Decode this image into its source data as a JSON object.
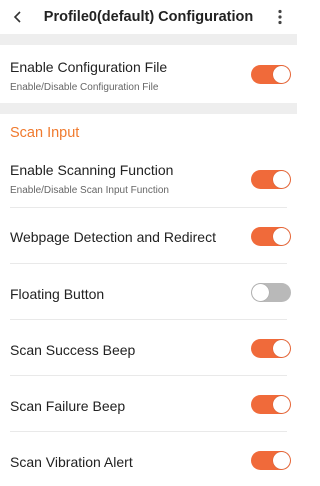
{
  "header": {
    "back_icon": "back-chevron-icon",
    "title": "Profile0(default) Configuration",
    "more_icon": "more-vertical-icon"
  },
  "profile": {
    "label": "Enable Configuration File",
    "sub": "Enable/Disable Configuration File",
    "enabled": true
  },
  "scan_input": {
    "section_title": "Scan Input",
    "items": [
      {
        "label": "Enable Scanning Function",
        "sub": "Enable/Disable Scan Input Function",
        "enabled": true
      },
      {
        "label": "Webpage Detection and Redirect",
        "enabled": true
      },
      {
        "label": "Floating Button",
        "enabled": false
      },
      {
        "label": "Scan Success Beep",
        "enabled": true
      },
      {
        "label": "Scan Failure Beep",
        "enabled": true
      },
      {
        "label": "Scan Vibration Alert",
        "enabled": true
      }
    ]
  },
  "colors": {
    "accent": "#f06a3a",
    "section": "#f07a2e",
    "toggle_off": "#b9b9b9"
  }
}
